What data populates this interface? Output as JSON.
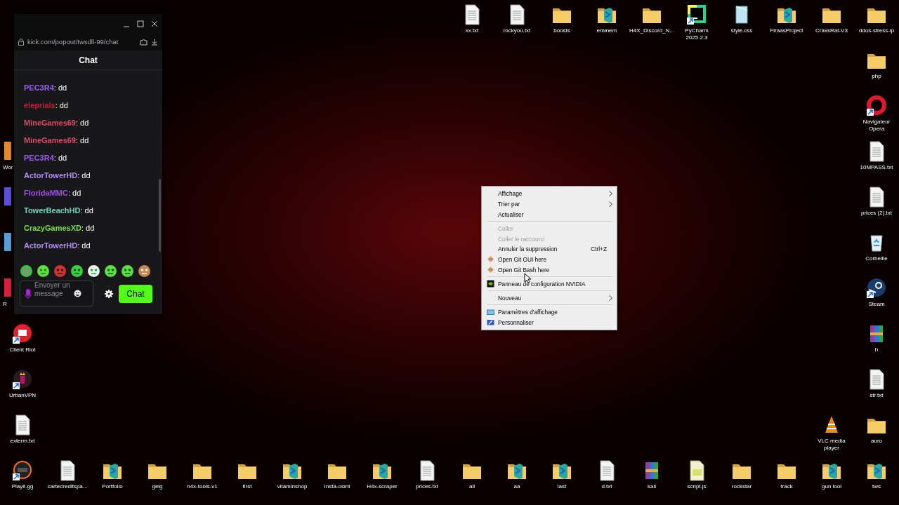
{
  "desktop": {
    "top_row": [
      {
        "label": "xx.txt",
        "kind": "text-file"
      },
      {
        "label": "rockyou.txt",
        "kind": "text-file"
      },
      {
        "label": "boosts",
        "kind": "folder"
      },
      {
        "label": "eminem",
        "kind": "code-folder"
      },
      {
        "label": "H4X_Discord_N...",
        "kind": "folder"
      },
      {
        "label": "PyCharm 2025.2.3",
        "kind": "ide",
        "shortcut": true
      },
      {
        "label": "style.css",
        "kind": "stylesheet"
      },
      {
        "label": "FiraasProject",
        "kind": "code-folder"
      },
      {
        "label": "CraxsRat-V3",
        "kind": "folder"
      },
      {
        "label": "ddos-stress-ip",
        "kind": "folder"
      }
    ],
    "right_column": [
      {
        "label": "php",
        "kind": "folder"
      },
      {
        "label": "Navigateur Opera",
        "kind": "browser",
        "shortcut": true
      },
      {
        "label": "10MPASS.txt",
        "kind": "text-file"
      },
      {
        "label": "prices (2).txt",
        "kind": "text-file"
      },
      {
        "label": "Corbeille",
        "kind": "recycle-bin"
      },
      {
        "label": "Steam",
        "kind": "game-launcher",
        "shortcut": true
      },
      {
        "label": "h",
        "kind": "archive"
      },
      {
        "label": "str.txt",
        "kind": "text-file"
      },
      {
        "label": "auro",
        "kind": "folder"
      }
    ],
    "inner_column": [
      {
        "label": "VLC media player",
        "kind": "media-player"
      }
    ],
    "left_column": [
      {
        "label": "Wor",
        "kind": "app",
        "color": "#e08a2c"
      },
      {
        "kind": "app",
        "color": "#5a4fd8"
      },
      {
        "kind": "app",
        "color": "#5aa0d8"
      },
      {
        "label": "R",
        "kind": "app",
        "color": "#d8203a"
      },
      {
        "label": "Client Riot",
        "kind": "riot",
        "shortcut": true
      },
      {
        "label": "UrbanVPN",
        "kind": "vpn",
        "shortcut": true
      },
      {
        "label": "exterm.txt",
        "kind": "text-file"
      }
    ],
    "bottom_row": [
      {
        "label": "Playit.gg",
        "kind": "playit",
        "shortcut": true
      },
      {
        "label": "cartecreditspa...",
        "kind": "text-file"
      },
      {
        "label": "Portfolio",
        "kind": "code-folder"
      },
      {
        "label": "gelg",
        "kind": "folder"
      },
      {
        "label": "h4x-tools-v1",
        "kind": "folder"
      },
      {
        "label": "first",
        "kind": "folder"
      },
      {
        "label": "vitaminshop",
        "kind": "code-folder"
      },
      {
        "label": "Insta-osint",
        "kind": "folder"
      },
      {
        "label": "H4x-scraper",
        "kind": "code-folder"
      },
      {
        "label": "prices.txt",
        "kind": "text-file"
      },
      {
        "label": "all",
        "kind": "folder"
      },
      {
        "label": "aa",
        "kind": "code-folder"
      },
      {
        "label": "last",
        "kind": "code-folder"
      },
      {
        "label": "d.txt",
        "kind": "text-file"
      },
      {
        "label": "kali",
        "kind": "archive"
      },
      {
        "label": "script.js",
        "kind": "script"
      },
      {
        "label": "rockstar",
        "kind": "folder"
      },
      {
        "label": "track",
        "kind": "folder"
      },
      {
        "label": "gun lool",
        "kind": "code-folder"
      },
      {
        "label": "tws",
        "kind": "code-folder"
      }
    ]
  },
  "chat": {
    "url": "kick.com/popout/twsdll-99/chat",
    "title": "Chat",
    "messages": [
      {
        "user": "PEC3R4",
        "text": ": dd",
        "color": "#9b5cf0"
      },
      {
        "user": "eleprials",
        "text": ": dd",
        "color": "#d0193a"
      },
      {
        "user": "MineGames69",
        "text": ": dd",
        "color": "#e04a68"
      },
      {
        "user": "MineGames69",
        "text": ": dd",
        "color": "#e04a68"
      },
      {
        "user": "PEC3R4",
        "text": ": dd",
        "color": "#9b5cf0"
      },
      {
        "user": "ActorTowerHD",
        "text": ": dd",
        "color": "#b48cf2"
      },
      {
        "user": "FloridaMMC",
        "text": ": dd",
        "color": "#a04de6"
      },
      {
        "user": "TowerBeachHD",
        "text": ": dd",
        "color": "#72d6bc"
      },
      {
        "user": "CrazyGamesXD",
        "text": ": dd",
        "color": "#70e63a"
      },
      {
        "user": "ActorTowerHD",
        "text": ": dd",
        "color": "#b48cf2"
      }
    ],
    "input": {
      "placeholder": "Envoyer un message"
    },
    "send_button": "Chat"
  },
  "context_menu": {
    "items": [
      {
        "kind": "item",
        "label": "Affichage",
        "disabled": false,
        "submenu": true
      },
      {
        "kind": "item",
        "label": "Trier par",
        "disabled": false,
        "submenu": true
      },
      {
        "kind": "item",
        "label": "Actualiser",
        "disabled": false,
        "submenu": false
      },
      {
        "kind": "separator"
      },
      {
        "kind": "item",
        "label": "Coller",
        "disabled": true,
        "submenu": false
      },
      {
        "kind": "item",
        "label": "Coller le raccourci",
        "disabled": true,
        "submenu": false
      },
      {
        "kind": "item",
        "label": "Annuler la suppression",
        "shortcut": "Ctrl+Z",
        "disabled": false,
        "submenu": false
      },
      {
        "kind": "item",
        "label": "Open Git GUI here",
        "disabled": false,
        "submenu": false
      },
      {
        "kind": "item",
        "label": "Open Git Bash here",
        "disabled": false,
        "submenu": false
      },
      {
        "kind": "separator"
      },
      {
        "kind": "item",
        "label": "Panneau de configuration NVIDIA",
        "disabled": false,
        "submenu": false
      },
      {
        "kind": "separator"
      },
      {
        "kind": "item",
        "label": "Nouveau",
        "disabled": false,
        "submenu": true
      },
      {
        "kind": "separator"
      },
      {
        "kind": "item",
        "label": "Paramètres d'affichage",
        "disabled": false,
        "submenu": false
      },
      {
        "kind": "item",
        "label": "Personnaliser",
        "disabled": false,
        "submenu": false
      }
    ]
  }
}
